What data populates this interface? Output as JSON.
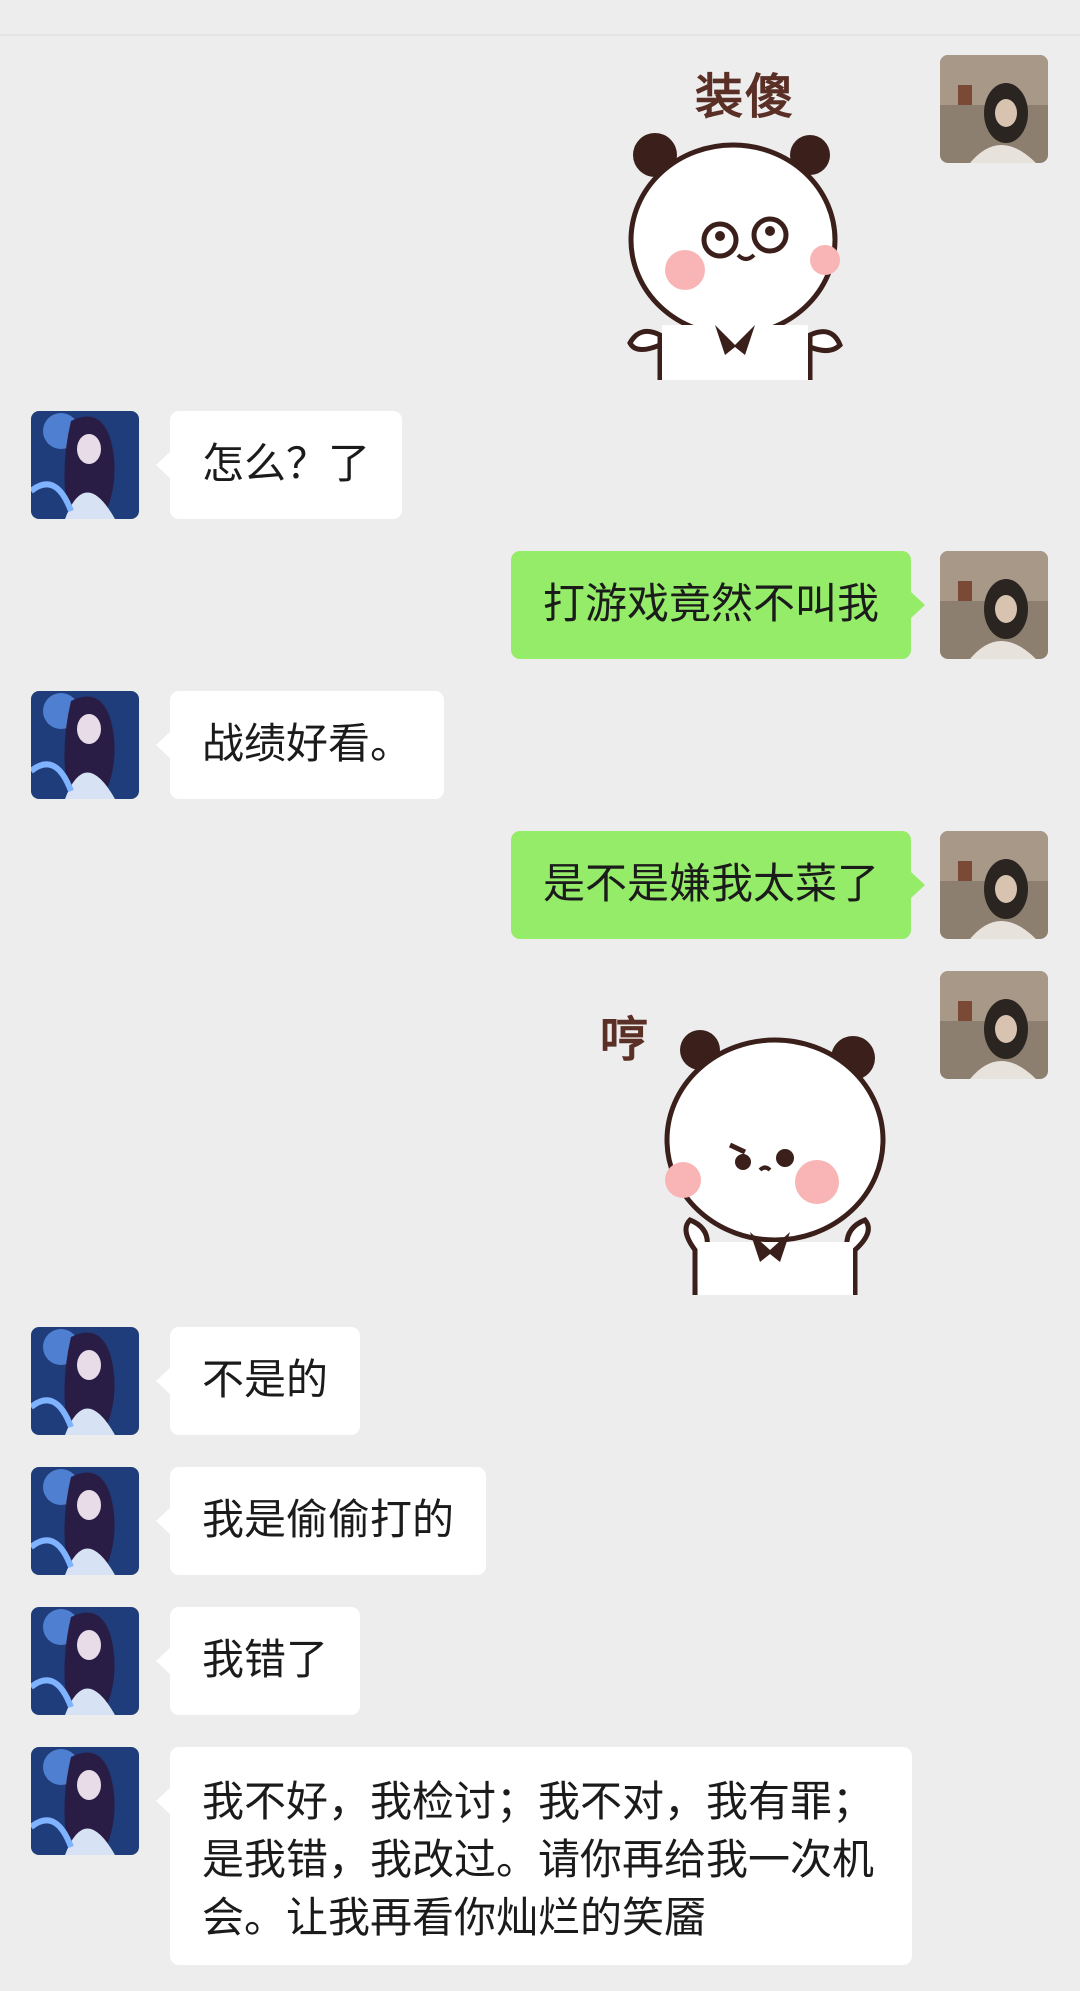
{
  "chat": {
    "messages": [
      {
        "side": "right",
        "type": "sticker",
        "sticker_text": "装傻"
      },
      {
        "side": "left",
        "type": "text",
        "text": "怎么？了"
      },
      {
        "side": "right",
        "type": "text",
        "text": "打游戏竟然不叫我"
      },
      {
        "side": "left",
        "type": "text",
        "text": "战绩好看。"
      },
      {
        "side": "right",
        "type": "text",
        "text": "是不是嫌我太菜了"
      },
      {
        "side": "right",
        "type": "sticker",
        "sticker_text": "哼"
      },
      {
        "side": "left",
        "type": "text",
        "text": "不是的"
      },
      {
        "side": "left",
        "type": "text",
        "text": "我是偷偷打的"
      },
      {
        "side": "left",
        "type": "text",
        "text": "我错了"
      },
      {
        "side": "left",
        "type": "text",
        "text": "我不好，我检讨；我不对，我有罪；是我错，我改过。请你再给我一次机会。让我再看你灿烂的笑靥"
      }
    ]
  },
  "colors": {
    "background": "#ededed",
    "incoming_bubble": "#ffffff",
    "outgoing_bubble": "#95ec69"
  },
  "icons": {
    "self_avatar": "girl-photo-avatar",
    "contact_avatar": "anime-character-avatar",
    "sticker": "panda-bear-sticker"
  }
}
